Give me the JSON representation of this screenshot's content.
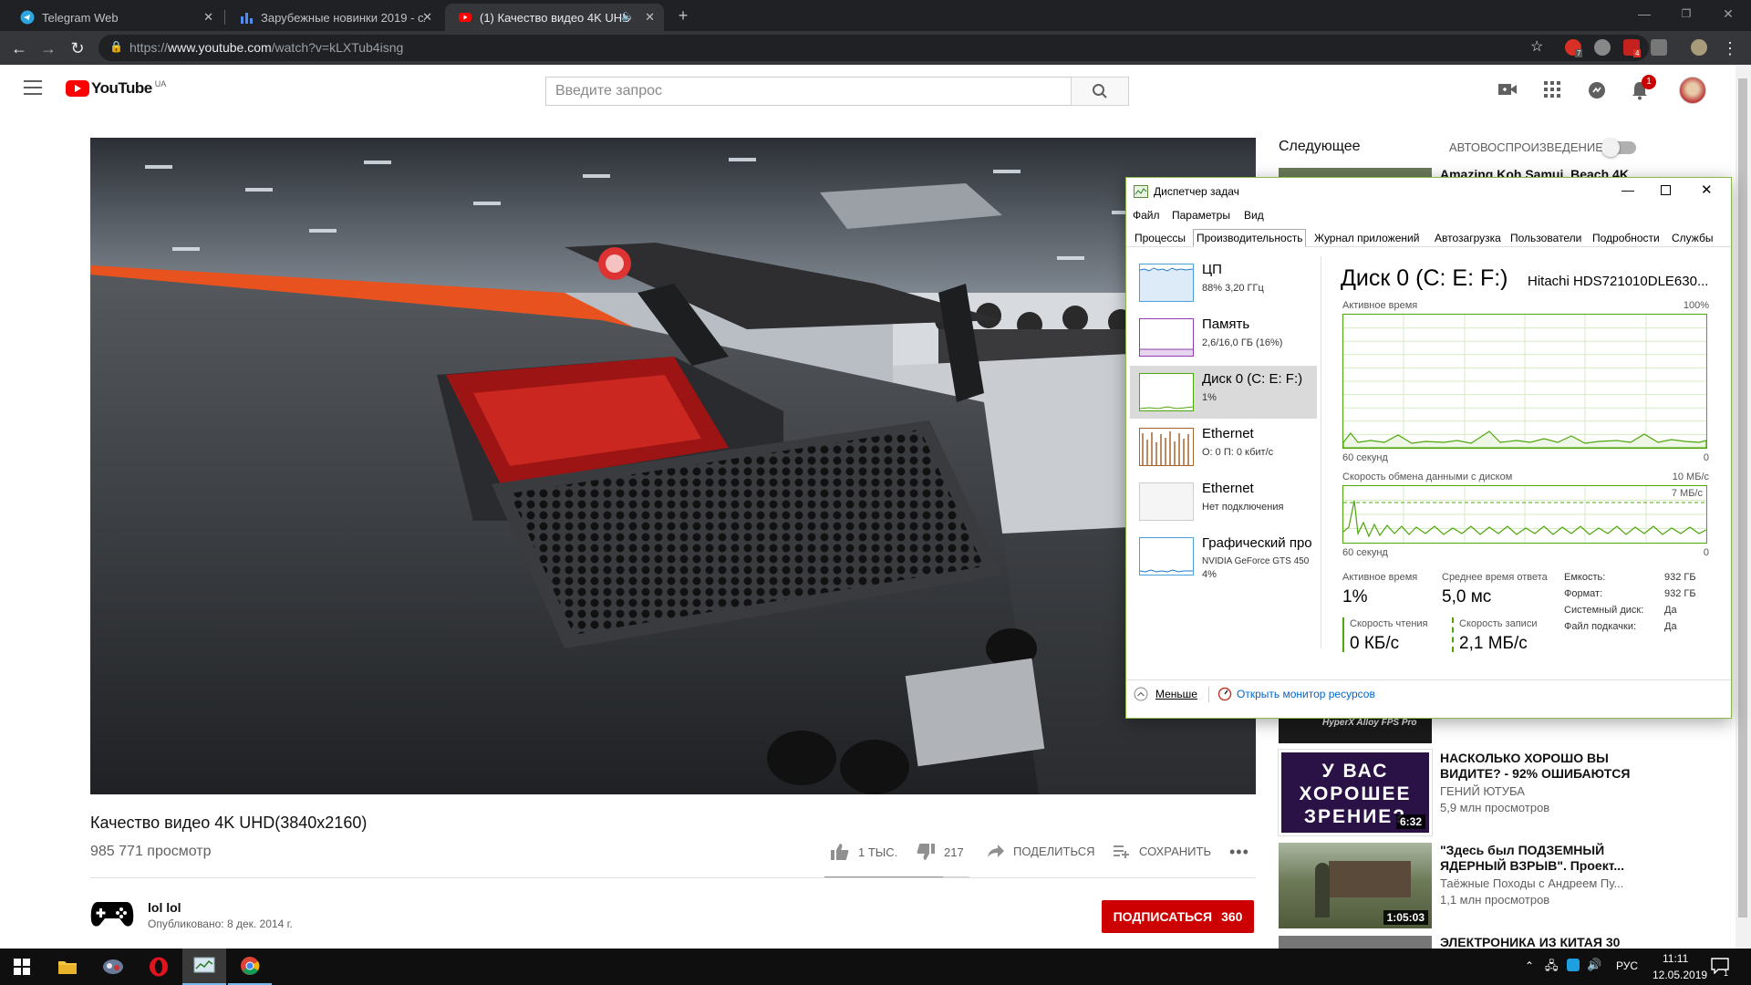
{
  "browser": {
    "tabs": [
      {
        "title": "Telegram Web"
      },
      {
        "title": "Зарубежные новинки 2019 - сл"
      },
      {
        "title": "(1) Качество видео 4K UHD("
      }
    ],
    "url_scheme": "https://",
    "url_host": "www.youtube.com",
    "url_path": "/watch?v=kLXTub4isng",
    "extension_badge": "7",
    "extension_badge2": "4"
  },
  "youtube": {
    "logo": "YouTube",
    "region": "UA",
    "search_placeholder": "Введите запрос",
    "notif_count": "1",
    "video": {
      "title": "Качество видео 4K UHD(3840x2160)",
      "views": "985 771 просмотр",
      "likes": "1 ТЫС.",
      "dislikes": "217",
      "share": "ПОДЕЛИТЬСЯ",
      "save": "СОХРАНИТЬ",
      "like_ratio": 0.82
    },
    "channel": {
      "name": "lol lol",
      "published": "Опубликовано: 8 дек. 2014 г.",
      "subscribe": "ПОДПИСАТЬСЯ",
      "subs": "360"
    },
    "sidebar": {
      "up_next": "Следующее",
      "autoplay": "АВТОВОСПРОИЗВЕДЕНИЕ",
      "recs": [
        {
          "title": "Amazing Koh Samui, Beach 4K",
          "channel": "",
          "views": "",
          "duration": ""
        },
        {
          "title": "НАСКОЛЬКО ХОРОШО ВЫ ВИДИТЕ? - 92% ОШИБАЮТСЯ",
          "channel": "ГЕНИЙ ЮТУБА",
          "views": "5,9 млн просмотров",
          "duration": "6:32",
          "thumb_text": "У ВАС ХОРОШЕЕ ЗРЕНИЕ?"
        },
        {
          "title": "\"Здесь был ПОДЗЕМНЫЙ ЯДЕРНЫЙ ВЗРЫВ\". Проект...",
          "channel": "Таёжные Походы с Андреем Пу...",
          "views": "1,1 млн просмотров",
          "duration": "1:05:03"
        },
        {
          "title": "ЭЛЕКТРОНИКА ИЗ КИТАЯ 30",
          "channel": "",
          "views": "",
          "duration": ""
        }
      ],
      "hyperx_text": "HyperX Alloy FPS Pro"
    }
  },
  "taskmanager": {
    "title": "Диспетчер задач",
    "menu": [
      "Файл",
      "Параметры",
      "Вид"
    ],
    "tabs": [
      "Процессы",
      "Производительность",
      "Журнал приложений",
      "Автозагрузка",
      "Пользователи",
      "Подробности",
      "Службы"
    ],
    "resources": [
      {
        "name": "ЦП",
        "sub": "88% 3,20 ГГц"
      },
      {
        "name": "Память",
        "sub": "2,6/16,0 ГБ (16%)"
      },
      {
        "name": "Диск 0 (C: E: F:)",
        "sub": "1%"
      },
      {
        "name": "Ethernet",
        "sub": "О: 0 П: 0 кбит/с"
      },
      {
        "name": "Ethernet",
        "sub": "Нет подключения"
      },
      {
        "name": "Графический про",
        "sub": "NVIDIA GeForce GTS 450",
        "sub2": "4%"
      }
    ],
    "disk": {
      "heading": "Диск 0 (C: E: F:)",
      "model": "Hitachi HDS721010DLE630...",
      "active_time_label": "Активное время",
      "active_time_max": "100%",
      "seconds": "60 секунд",
      "zero": "0",
      "transfer_label": "Скорость обмена данными с диском",
      "transfer_max": "10 МБ/с",
      "transfer_mark": "7 МБ/с",
      "stats": {
        "active_label": "Активное время",
        "active_value": "1%",
        "resp_label": "Среднее время ответа",
        "resp_value": "5,0 мс",
        "read_label": "Скорость чтения",
        "read_value": "0 КБ/с",
        "write_label": "Скорость записи",
        "write_value": "2,1 МБ/с"
      },
      "props": [
        {
          "k": "Емкость:",
          "v": "932 ГБ"
        },
        {
          "k": "Формат:",
          "v": "932 ГБ"
        },
        {
          "k": "Системный диск:",
          "v": "Да"
        },
        {
          "k": "Файл подкачки:",
          "v": "Да"
        }
      ]
    },
    "fewer": "Меньше",
    "open_monitor": "Открыть монитор ресурсов"
  },
  "taskbar": {
    "lang": "РУС",
    "time": "11:11",
    "date": "12.05.2019",
    "notif": "1"
  }
}
